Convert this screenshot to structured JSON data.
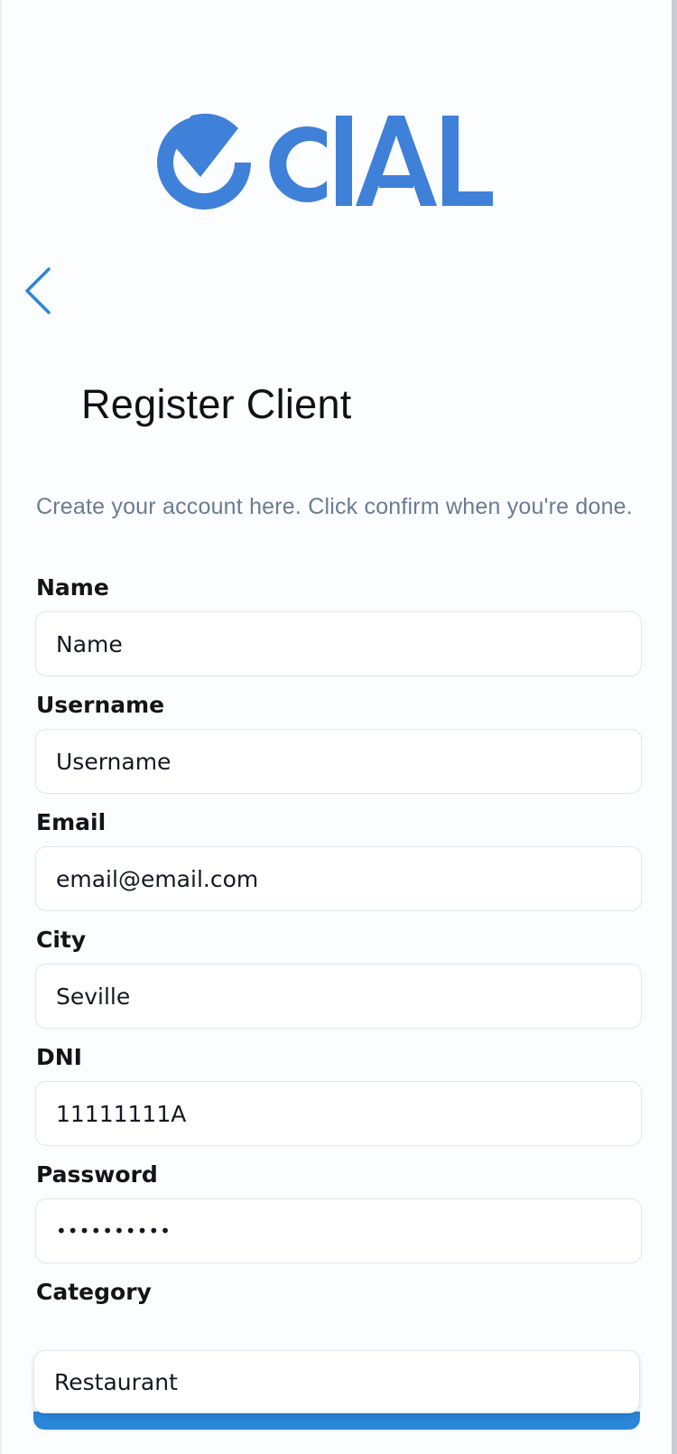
{
  "brand": {
    "logo_text": "OCIAL",
    "color": "#3f80d8"
  },
  "nav": {
    "back_icon": "chevron-left-icon"
  },
  "header": {
    "title": "Register Client",
    "subtitle": "Create your account here. Click confirm when you're done."
  },
  "form": {
    "name": {
      "label": "Name",
      "value": "Name"
    },
    "username": {
      "label": "Username",
      "value": "Username"
    },
    "email": {
      "label": "Email",
      "value": "email@email.com"
    },
    "city": {
      "label": "City",
      "value": "Seville"
    },
    "dni": {
      "label": "DNI",
      "value": "11111111A"
    },
    "password": {
      "label": "Password",
      "value": "••••••••••"
    },
    "category": {
      "label": "Category",
      "value": "Restaurant"
    }
  },
  "colors": {
    "accent": "#2a86d9",
    "subtitle": "#6a7b93"
  }
}
